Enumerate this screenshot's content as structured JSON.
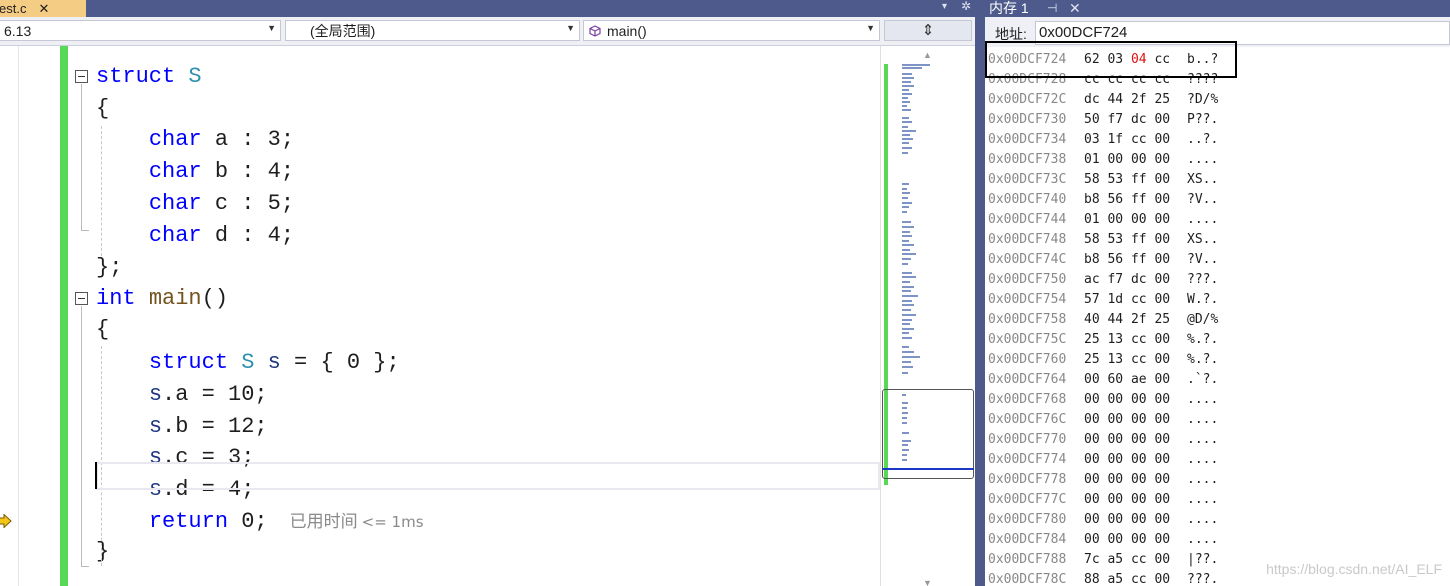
{
  "editor": {
    "tab": {
      "title": "est.c",
      "close": "✕"
    },
    "tab_overflow": "▾",
    "tab_gear": "✲",
    "nav": {
      "project": "6.13",
      "scope": "(全局范围)",
      "function": "main()",
      "split_glyph": "⇕"
    },
    "code_lines": [
      {
        "tokens": [
          {
            "t": "struct",
            "c": "kw"
          },
          {
            "t": " ",
            "c": "pl"
          },
          {
            "t": "S",
            "c": "ty"
          }
        ]
      },
      {
        "tokens": [
          {
            "t": "{",
            "c": "pl"
          }
        ]
      },
      {
        "tokens": [
          {
            "t": "    ",
            "c": "pl"
          },
          {
            "t": "char",
            "c": "kw"
          },
          {
            "t": " a : 3;",
            "c": "pl"
          }
        ]
      },
      {
        "tokens": [
          {
            "t": "    ",
            "c": "pl"
          },
          {
            "t": "char",
            "c": "kw"
          },
          {
            "t": " b : 4;",
            "c": "pl"
          }
        ]
      },
      {
        "tokens": [
          {
            "t": "    ",
            "c": "pl"
          },
          {
            "t": "char",
            "c": "kw"
          },
          {
            "t": " c : 5;",
            "c": "pl"
          }
        ]
      },
      {
        "tokens": [
          {
            "t": "    ",
            "c": "pl"
          },
          {
            "t": "char",
            "c": "kw"
          },
          {
            "t": " d : 4;",
            "c": "pl"
          }
        ]
      },
      {
        "tokens": [
          {
            "t": "};",
            "c": "pl"
          }
        ]
      },
      {
        "tokens": [
          {
            "t": "int",
            "c": "kw"
          },
          {
            "t": " ",
            "c": "pl"
          },
          {
            "t": "main",
            "c": "fn"
          },
          {
            "t": "()",
            "c": "pl"
          }
        ]
      },
      {
        "tokens": [
          {
            "t": "{",
            "c": "pl"
          }
        ]
      },
      {
        "tokens": [
          {
            "t": "    ",
            "c": "pl"
          },
          {
            "t": "struct",
            "c": "kw"
          },
          {
            "t": " ",
            "c": "pl"
          },
          {
            "t": "S",
            "c": "ty"
          },
          {
            "t": " ",
            "c": "pl"
          },
          {
            "t": "s",
            "c": "vr"
          },
          {
            "t": " = { 0 };",
            "c": "pl"
          }
        ]
      },
      {
        "tokens": [
          {
            "t": "    ",
            "c": "pl"
          },
          {
            "t": "s",
            "c": "vr"
          },
          {
            "t": ".a = 10;",
            "c": "pl"
          }
        ]
      },
      {
        "tokens": [
          {
            "t": "    ",
            "c": "pl"
          },
          {
            "t": "s",
            "c": "vr"
          },
          {
            "t": ".b = 12;",
            "c": "pl"
          }
        ]
      },
      {
        "tokens": [
          {
            "t": "    ",
            "c": "pl"
          },
          {
            "t": "s",
            "c": "vr"
          },
          {
            "t": ".c = 3;",
            "c": "pl"
          }
        ]
      },
      {
        "tokens": [
          {
            "t": "    ",
            "c": "pl"
          },
          {
            "t": "s",
            "c": "vr"
          },
          {
            "t": ".d = 4;",
            "c": "pl"
          }
        ]
      },
      {
        "tokens": [
          {
            "t": "    ",
            "c": "pl"
          },
          {
            "t": "return",
            "c": "kw"
          },
          {
            "t": " 0;",
            "c": "pl"
          }
        ],
        "hint": "已用时间",
        "hint_small": "<= 1ms"
      },
      {
        "tokens": [
          {
            "t": "}",
            "c": "pl"
          }
        ]
      }
    ],
    "map_glyphs": {
      "up": "▲",
      "down": "▼"
    }
  },
  "memory": {
    "title": "内存 1",
    "pin": "⊣",
    "close": "✕",
    "address_label": "地址:",
    "address_value": "0x00DCF724",
    "rows": [
      {
        "addr": "0x00DCF724",
        "bytes": [
          "62",
          "03",
          "04",
          "cc"
        ],
        "changed": [
          2
        ],
        "ascii": "b..?"
      },
      {
        "addr": "0x00DCF728",
        "bytes": [
          "cc",
          "cc",
          "cc",
          "cc"
        ],
        "changed": [],
        "ascii": "????"
      },
      {
        "addr": "0x00DCF72C",
        "bytes": [
          "dc",
          "44",
          "2f",
          "25"
        ],
        "changed": [],
        "ascii": "?D/%"
      },
      {
        "addr": "0x00DCF730",
        "bytes": [
          "50",
          "f7",
          "dc",
          "00"
        ],
        "changed": [],
        "ascii": "P??."
      },
      {
        "addr": "0x00DCF734",
        "bytes": [
          "03",
          "1f",
          "cc",
          "00"
        ],
        "changed": [],
        "ascii": "..?."
      },
      {
        "addr": "0x00DCF738",
        "bytes": [
          "01",
          "00",
          "00",
          "00"
        ],
        "changed": [],
        "ascii": "...."
      },
      {
        "addr": "0x00DCF73C",
        "bytes": [
          "58",
          "53",
          "ff",
          "00"
        ],
        "changed": [],
        "ascii": "XS.."
      },
      {
        "addr": "0x00DCF740",
        "bytes": [
          "b8",
          "56",
          "ff",
          "00"
        ],
        "changed": [],
        "ascii": "?V.."
      },
      {
        "addr": "0x00DCF744",
        "bytes": [
          "01",
          "00",
          "00",
          "00"
        ],
        "changed": [],
        "ascii": "...."
      },
      {
        "addr": "0x00DCF748",
        "bytes": [
          "58",
          "53",
          "ff",
          "00"
        ],
        "changed": [],
        "ascii": "XS.."
      },
      {
        "addr": "0x00DCF74C",
        "bytes": [
          "b8",
          "56",
          "ff",
          "00"
        ],
        "changed": [],
        "ascii": "?V.."
      },
      {
        "addr": "0x00DCF750",
        "bytes": [
          "ac",
          "f7",
          "dc",
          "00"
        ],
        "changed": [],
        "ascii": "???."
      },
      {
        "addr": "0x00DCF754",
        "bytes": [
          "57",
          "1d",
          "cc",
          "00"
        ],
        "changed": [],
        "ascii": "W.?."
      },
      {
        "addr": "0x00DCF758",
        "bytes": [
          "40",
          "44",
          "2f",
          "25"
        ],
        "changed": [],
        "ascii": "@D/%"
      },
      {
        "addr": "0x00DCF75C",
        "bytes": [
          "25",
          "13",
          "cc",
          "00"
        ],
        "changed": [],
        "ascii": "%.?."
      },
      {
        "addr": "0x00DCF760",
        "bytes": [
          "25",
          "13",
          "cc",
          "00"
        ],
        "changed": [],
        "ascii": "%.?."
      },
      {
        "addr": "0x00DCF764",
        "bytes": [
          "00",
          "60",
          "ae",
          "00"
        ],
        "changed": [],
        "ascii": ".`?."
      },
      {
        "addr": "0x00DCF768",
        "bytes": [
          "00",
          "00",
          "00",
          "00"
        ],
        "changed": [],
        "ascii": "...."
      },
      {
        "addr": "0x00DCF76C",
        "bytes": [
          "00",
          "00",
          "00",
          "00"
        ],
        "changed": [],
        "ascii": "...."
      },
      {
        "addr": "0x00DCF770",
        "bytes": [
          "00",
          "00",
          "00",
          "00"
        ],
        "changed": [],
        "ascii": "...."
      },
      {
        "addr": "0x00DCF774",
        "bytes": [
          "00",
          "00",
          "00",
          "00"
        ],
        "changed": [],
        "ascii": "...."
      },
      {
        "addr": "0x00DCF778",
        "bytes": [
          "00",
          "00",
          "00",
          "00"
        ],
        "changed": [],
        "ascii": "...."
      },
      {
        "addr": "0x00DCF77C",
        "bytes": [
          "00",
          "00",
          "00",
          "00"
        ],
        "changed": [],
        "ascii": "...."
      },
      {
        "addr": "0x00DCF780",
        "bytes": [
          "00",
          "00",
          "00",
          "00"
        ],
        "changed": [],
        "ascii": "...."
      },
      {
        "addr": "0x00DCF784",
        "bytes": [
          "00",
          "00",
          "00",
          "00"
        ],
        "changed": [],
        "ascii": "...."
      },
      {
        "addr": "0x00DCF788",
        "bytes": [
          "7c",
          "a5",
          "cc",
          "00"
        ],
        "changed": [],
        "ascii": "|??."
      },
      {
        "addr": "0x00DCF78C",
        "bytes": [
          "88",
          "a5",
          "cc",
          "00"
        ],
        "changed": [],
        "ascii": "???."
      }
    ]
  },
  "watermark": "https://blog.csdn.net/AI_ELF",
  "colors": {
    "keyword": "#0000ff",
    "type": "#2b91af",
    "function": "#74531f",
    "variable": "#1f377f",
    "changed_byte": "#e01010",
    "change_bar": "#57d957",
    "tab_strip": "#4d5a8b",
    "active_tab": "#f5cc84"
  }
}
